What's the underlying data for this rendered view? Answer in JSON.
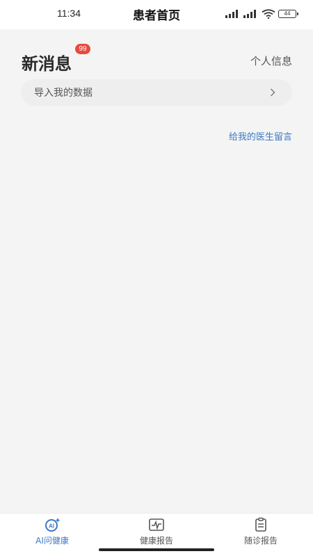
{
  "status_bar": {
    "time": "11:34",
    "battery": "44"
  },
  "header": {
    "title": "患者首页"
  },
  "messages": {
    "title": "新消息",
    "badge": "99",
    "profile_link": "个人信息"
  },
  "import_row": {
    "label": "导入我的数据",
    "icon": "chevron-right-icon"
  },
  "doctor_link": "给我的医生留言",
  "bottom_nav": {
    "items": [
      {
        "label": "AI问健康",
        "icon": "ai-health-icon",
        "active": true
      },
      {
        "label": "健康报告",
        "icon": "health-report-icon",
        "active": false
      },
      {
        "label": "随诊报告",
        "icon": "followup-report-icon",
        "active": false
      }
    ]
  },
  "colors": {
    "accent": "#3b78c4",
    "badge": "#e84a3f",
    "background": "#f4f4f5"
  }
}
